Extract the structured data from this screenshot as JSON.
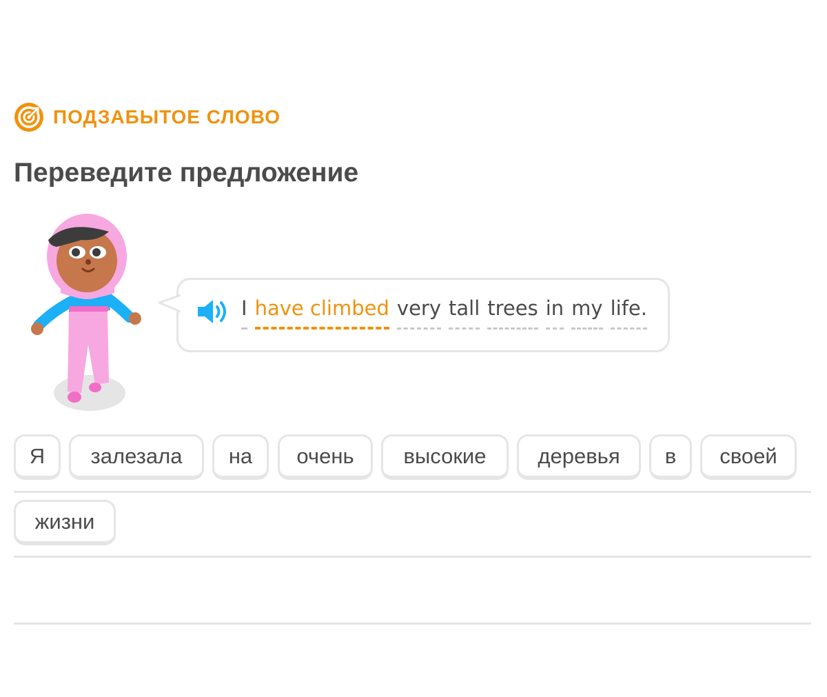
{
  "badge": {
    "label": "ПОДЗАБЫТОЕ СЛОВО",
    "icon": "target-refresh-icon",
    "color": "#f0920d"
  },
  "heading": "Переведите предложение",
  "prompt": {
    "speaker_icon": "speaker-icon",
    "tokens": [
      {
        "text": "I",
        "highlighted": false
      },
      {
        "text": "have climbed",
        "highlighted": true
      },
      {
        "text": "very",
        "highlighted": false
      },
      {
        "text": "tall",
        "highlighted": false
      },
      {
        "text": "trees",
        "highlighted": false
      },
      {
        "text": "in",
        "highlighted": false
      },
      {
        "text": "my",
        "highlighted": false
      },
      {
        "text": "life.",
        "highlighted": false
      }
    ]
  },
  "word_bank": [
    "Я",
    "залезала",
    "на",
    "очень",
    "высокие",
    "деревья",
    "в",
    "своей",
    "жизни"
  ],
  "colors": {
    "accent": "#f0920d",
    "text": "#4b4b4b",
    "border": "#e5e5e5",
    "speaker": "#1cb0f6"
  }
}
